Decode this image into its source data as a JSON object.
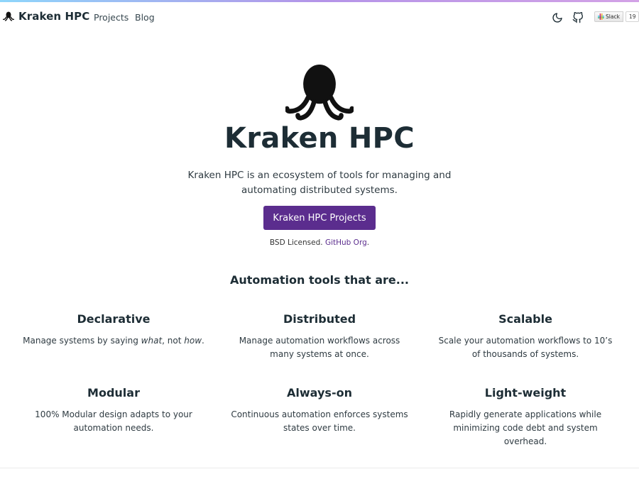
{
  "navbar": {
    "brand": "Kraken HPC",
    "links": [
      "Projects",
      "Blog"
    ],
    "icons": [
      "octopus-icon",
      "moon-icon",
      "github-icon",
      "slack-icon"
    ],
    "slack_badge": {
      "label": "Slack",
      "count": "19"
    }
  },
  "hero": {
    "title": "Kraken HPC",
    "lead": "Kraken HPC is an ecosystem of tools for managing and automating distributed systems.",
    "cta_label": "Kraken HPC Projects",
    "license_prefix": "BSD Licensed.",
    "license_link": "GitHub Org"
  },
  "features": {
    "heading": "Automation tools that are...",
    "items": [
      {
        "title": "Declarative",
        "text_before": "Manage systems by saying ",
        "em1": "what",
        "text_mid": ", not ",
        "em2": "how",
        "text_after": "."
      },
      {
        "title": "Distributed",
        "text": "Manage automation workflows across many systems at once."
      },
      {
        "title": "Scalable",
        "text": "Scale your automation workflows to 10’s of thousands of systems."
      },
      {
        "title": "Modular",
        "text": "100% Modular design adapts to your automation needs."
      },
      {
        "title": "Always-on",
        "text": "Continuous automation enforces systems states over time."
      },
      {
        "title": "Light-weight",
        "text": "Rapidly generate applications while minimizing code debt and system overhead."
      }
    ]
  },
  "colors": {
    "accent_purple": "#5b2d8e",
    "heading_text": "#1d2d35",
    "top_accent_gradient": [
      "#8ed6fb",
      "#b494e8",
      "#d3a2e6"
    ]
  }
}
